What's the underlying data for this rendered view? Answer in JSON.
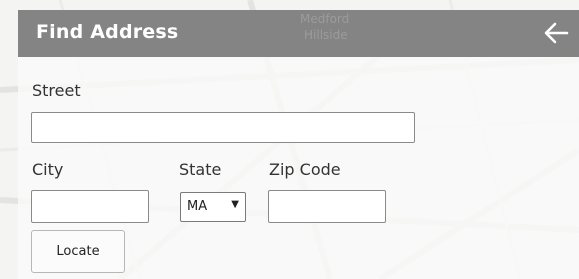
{
  "header": {
    "title": "Find Address",
    "back_icon": "arrow-left-icon"
  },
  "map": {
    "place_label_1": "Medford",
    "place_label_2": "Hillside"
  },
  "form": {
    "street_label": "Street",
    "street_value": "",
    "city_label": "City",
    "city_value": "",
    "state_label": "State",
    "state_value": "MA",
    "zip_label": "Zip Code",
    "zip_value": "",
    "locate_label": "Locate"
  },
  "colors": {
    "header_bg": "#848484",
    "header_text": "#ffffff"
  }
}
